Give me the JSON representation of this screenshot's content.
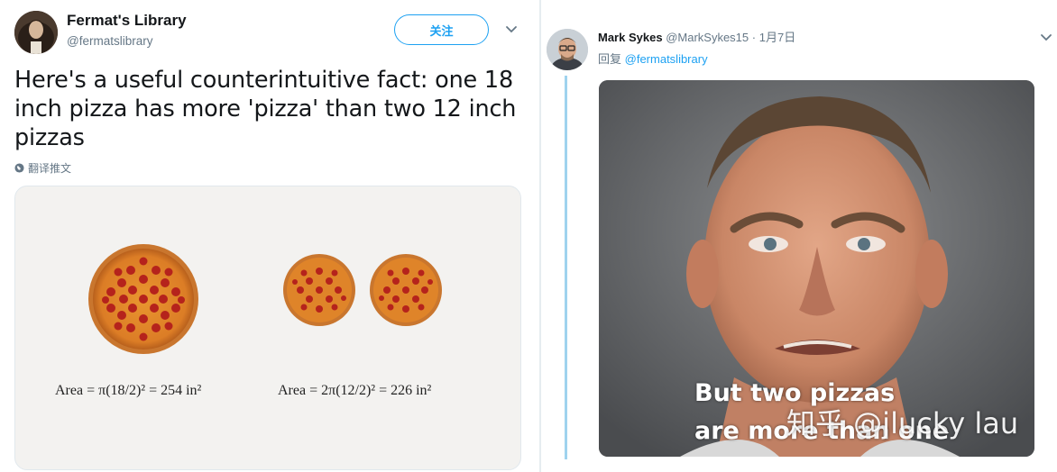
{
  "left_tweet": {
    "author_name": "Fermat's Library",
    "author_handle": "@fermatslibrary",
    "follow_label": "关注",
    "text": "Here's a useful counterintuitive fact: one 18 inch pizza has more 'pizza' than two 12 inch pizzas",
    "translate_label": "翻译推文",
    "media": {
      "formula_one": "Area = π(18/2)² = 254 in²",
      "formula_two": "Area = 2π(12/2)² = 226 in²"
    }
  },
  "right_tweet": {
    "author_name": "Mark Sykes",
    "author_handle": "@MarkSykes15",
    "separator": "·",
    "date": "1月7日",
    "reply_prefix": "回复",
    "reply_to": "@fermatslibrary",
    "meme": {
      "caption_line1": "But two pizzas",
      "caption_line2": "are more than one",
      "watermark": "知乎 @jlucky lau"
    }
  },
  "colors": {
    "accent": "#1da1f2",
    "thread_line": "#9fd3ee",
    "muted": "#657786",
    "pizza_crust": "#d97a2b",
    "pepperoni": "#b5231c"
  },
  "icons": [
    "avatar",
    "chevron-down-icon",
    "globe-icon",
    "pizza-image",
    "meme-photo"
  ]
}
